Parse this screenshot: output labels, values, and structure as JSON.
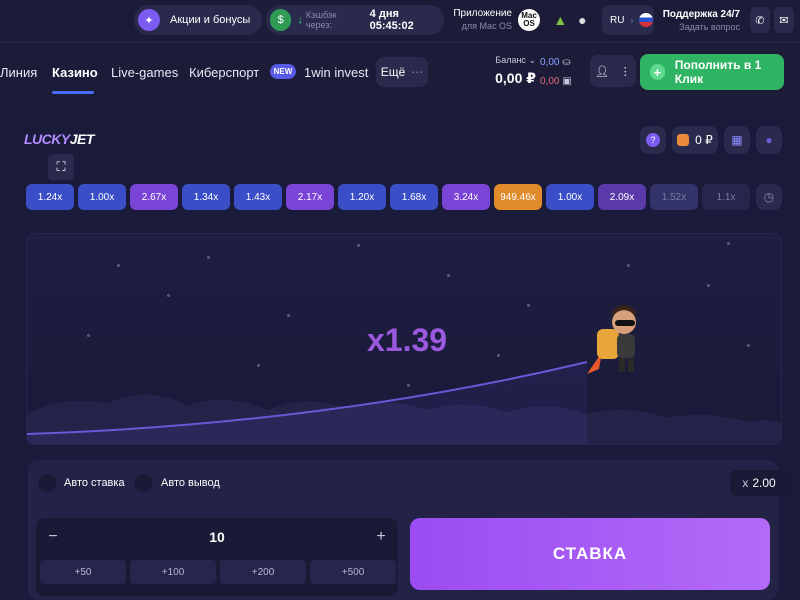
{
  "topbar": {
    "promo_label": "Акции и бонусы",
    "cashback_label": "Кэшбэк через:",
    "cashback_time": "4 дня 05:45:02",
    "app_title": "Приложение",
    "app_subtitle": "для Mac OS",
    "os_badge": "Mac OS",
    "lang": "RU",
    "support_title": "Поддержка 24/7",
    "support_subtitle": "Задать вопрос"
  },
  "nav": {
    "items": [
      "Линия",
      "Казино",
      "Live-games",
      "Киберспорт",
      "1win invest"
    ],
    "new_badge": "NEW",
    "more_label": "Ещё",
    "balance_label": "Баланс",
    "balance_value": "0,00 ₽",
    "bonus_balance_1": "0,00",
    "bonus_balance_2": "0,00",
    "deposit_label": "Пополнить в 1 Клик"
  },
  "game": {
    "logo_part1": "LUCKY",
    "logo_part2": "JET",
    "wallet_value": "0 ₽",
    "multipliers": [
      "1.24x",
      "1.00x",
      "2.67x",
      "1.34x",
      "1.43x",
      "2.17x",
      "1.20x",
      "1.68x",
      "3.24x",
      "949.46x",
      "1.00x",
      "2.09x",
      "1.52x",
      "1.1x"
    ],
    "multiplier_colors": [
      "#3a4fc7",
      "#3a4fc7",
      "#7a45d6",
      "#3a4fc7",
      "#3a4fc7",
      "#7a45d6",
      "#3a4fc7",
      "#3a4fc7",
      "#7a45d6",
      "#e08a2a",
      "#3a4fc7",
      "#5a3aa8",
      "#33336a",
      "#26264c"
    ],
    "current_multiplier": "x1.39"
  },
  "bet": {
    "auto_bet_label": "Авто ставка",
    "auto_cashout_label": "Авто вывод",
    "cashout_prefix": "x",
    "cashout_value": "2.00",
    "minus": "−",
    "plus": "+",
    "amount": "10",
    "quick_amounts": [
      "+50",
      "+100",
      "+200",
      "+500"
    ],
    "submit_label": "СТАВКА"
  }
}
